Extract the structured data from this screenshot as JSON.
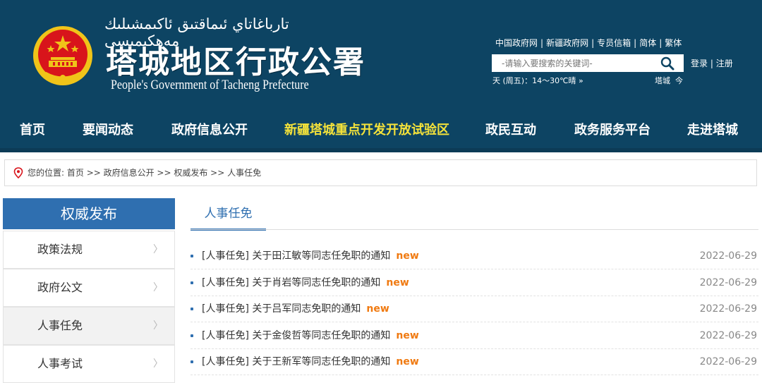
{
  "header": {
    "uyghur_title": "تارباغاتاي ئىماقتىق ئاكىمشىلىك مەھكىمىسى",
    "cn_title": "塔城地区行政公署",
    "en_title": "People's  Government of Tacheng Prefecture",
    "top_links": [
      "中国政府网",
      "新疆政府网",
      "专员信箱",
      "简体",
      "繁体"
    ],
    "search_placeholder": "-请输入要搜索的关键词-",
    "login": "登录",
    "register": "注册",
    "weather": "天 (周五)：14～30℃晴",
    "weather_more": "»",
    "city": "塔城",
    "city_suffix": "今"
  },
  "nav": {
    "items": [
      "首页",
      "要闻动态",
      "政府信息公开",
      "新疆塔城重点开发开放试验区",
      "政民互动",
      "政务服务平台",
      "走进塔城"
    ]
  },
  "breadcrumb": {
    "label": "您的位置:",
    "path": "首页 >> 政府信息公开 >> 权威发布 >> 人事任免"
  },
  "sidebar": {
    "title": "权威发布",
    "items": [
      "政策法规",
      "政府公文",
      "人事任免",
      "人事考试"
    ],
    "arrow": "〉"
  },
  "main": {
    "tab": "人事任免",
    "new_label": "new",
    "news": [
      {
        "title": "[人事任免] 关于田江敏等同志任免职的通知",
        "date": "2022-06-29"
      },
      {
        "title": "[人事任免] 关于肖岩等同志任免职的通知",
        "date": "2022-06-29"
      },
      {
        "title": "[人事任免] 关于吕军同志免职的通知",
        "date": "2022-06-29"
      },
      {
        "title": "[人事任免] 关于金俊哲等同志任免职的通知",
        "date": "2022-06-29"
      },
      {
        "title": "[人事任免] 关于王新军等同志任免职的通知",
        "date": "2022-06-29"
      }
    ]
  },
  "colors": {
    "header_bg": "#0d4463",
    "accent_blue": "#2f6fb0",
    "new_orange": "#f07a11",
    "nav_highlight": "#f4e23a",
    "emblem_red": "#d8141b",
    "emblem_gold": "#f0c419"
  },
  "icons": {
    "emblem": "national-emblem",
    "search": "search-icon",
    "location": "location-pin-icon"
  }
}
